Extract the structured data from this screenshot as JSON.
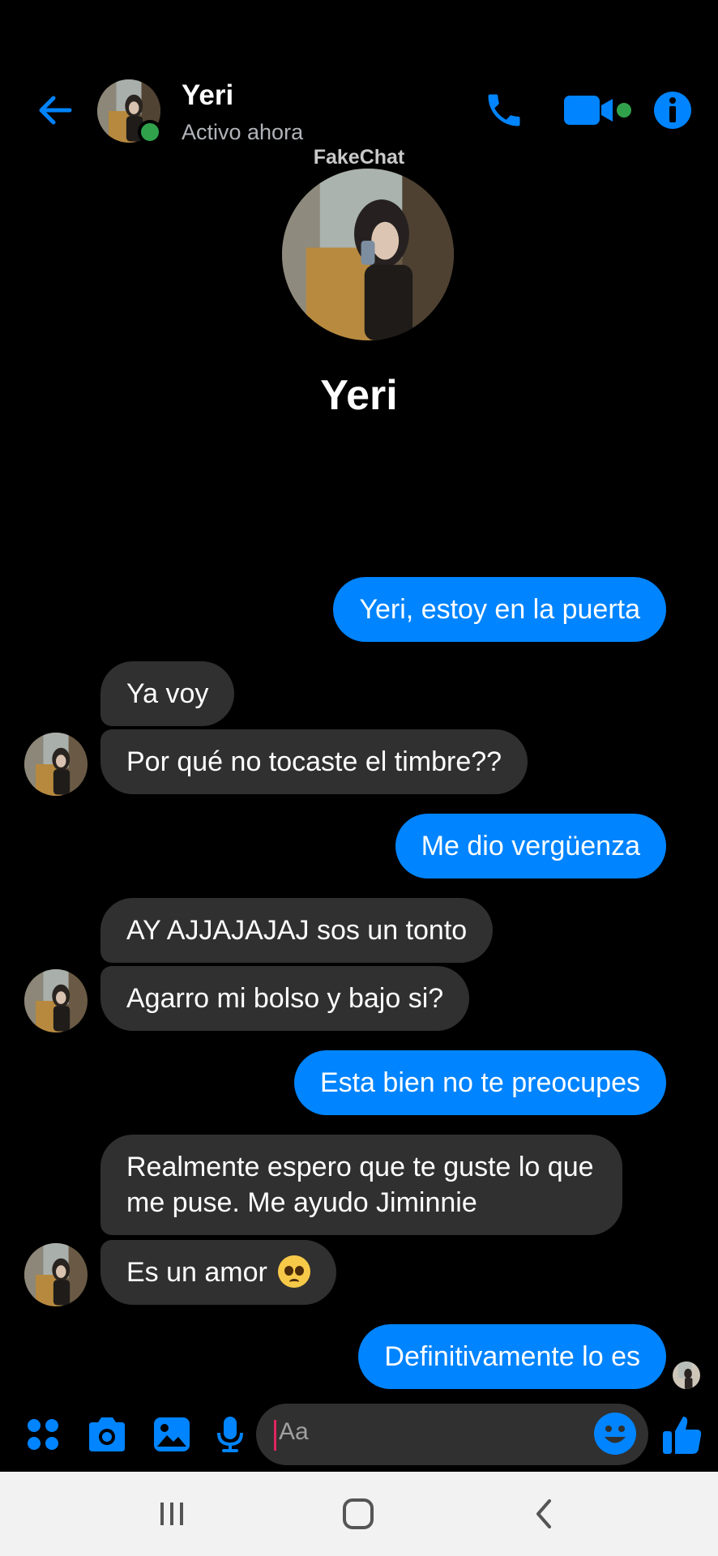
{
  "header": {
    "contact_name": "Yeri",
    "status": "Activo ahora",
    "watermark": "FakeChat"
  },
  "profile": {
    "name": "Yeri"
  },
  "messages": [
    {
      "direction": "out",
      "text": "Yeri, estoy en la puerta"
    },
    {
      "direction": "in",
      "text": "Ya voy"
    },
    {
      "direction": "in",
      "text": "Por qué no tocaste el timbre??"
    },
    {
      "direction": "out",
      "text": "Me dio vergüenza"
    },
    {
      "direction": "in",
      "text": "AY AJJAJAJAJ sos un tonto"
    },
    {
      "direction": "in",
      "text": "Agarro mi bolso y bajo si?"
    },
    {
      "direction": "out",
      "text": "Esta bien no te preocupes"
    },
    {
      "direction": "in",
      "text": "Realmente espero que te guste lo que me puse. Me ayudo Jiminnie"
    },
    {
      "direction": "in",
      "text": "Es un amor",
      "emoji": "pleading-face"
    },
    {
      "direction": "out",
      "text": "Definitivamente lo es"
    }
  ],
  "composer": {
    "placeholder": "Aa"
  },
  "colors": {
    "accent": "#0084ff",
    "incoming_bubble": "#303030",
    "online": "#31a24c",
    "background": "#000000"
  },
  "icons": {
    "back": "arrow-left-icon",
    "call": "phone-icon",
    "video": "video-camera-icon",
    "info": "info-icon",
    "apps": "apps-grid-icon",
    "camera": "camera-icon",
    "gallery": "image-icon",
    "mic": "microphone-icon",
    "emoji": "smiley-icon",
    "like": "thumbs-up-icon"
  }
}
